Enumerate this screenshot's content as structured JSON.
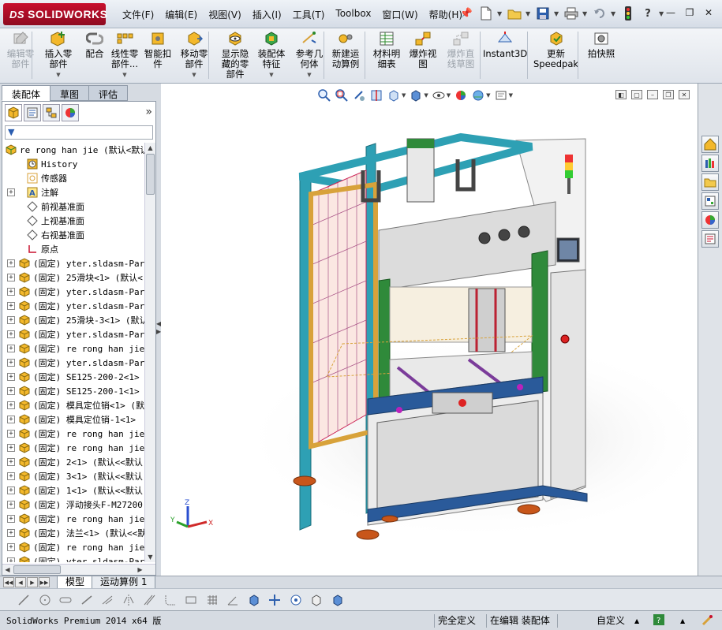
{
  "app": {
    "brand": "SOLIDWORKS",
    "brand_prefix": "DS"
  },
  "menu": [
    "文件(F)",
    "编辑(E)",
    "视图(V)",
    "插入(I)",
    "工具(T)",
    "Toolbox",
    "窗口(W)",
    "帮助(H)"
  ],
  "commands": [
    {
      "label": "编辑零\n部件",
      "icon": "edit-component-icon",
      "enabled": false,
      "dropdown": false
    },
    {
      "label": "插入零\n部件",
      "icon": "insert-component-icon",
      "enabled": true,
      "dropdown": true
    },
    {
      "label": "配合",
      "icon": "mate-icon",
      "enabled": true,
      "dropdown": false
    },
    {
      "label": "线性零\n部件...",
      "icon": "linear-pattern-icon",
      "enabled": true,
      "dropdown": true
    },
    {
      "label": "智能扣\n件",
      "icon": "smart-fasteners-icon",
      "enabled": true,
      "dropdown": false
    },
    {
      "label": "移动零\n部件",
      "icon": "move-component-icon",
      "enabled": true,
      "dropdown": true
    },
    {
      "label": "显示隐\n藏的零\n部件",
      "icon": "show-hidden-icon",
      "enabled": true,
      "dropdown": false
    },
    {
      "label": "装配体\n特征",
      "icon": "assembly-feature-icon",
      "enabled": true,
      "dropdown": true
    },
    {
      "label": "参考几\n何体",
      "icon": "reference-geometry-icon",
      "enabled": true,
      "dropdown": true
    },
    {
      "label": "新建运\n动算例",
      "icon": "new-motion-study-icon",
      "enabled": true,
      "dropdown": false
    },
    {
      "label": "材料明\n细表",
      "icon": "bom-icon",
      "enabled": true,
      "dropdown": false
    },
    {
      "label": "爆炸视\n图",
      "icon": "exploded-view-icon",
      "enabled": true,
      "dropdown": false
    },
    {
      "label": "爆炸直\n线草图",
      "icon": "explode-line-sketch-icon",
      "enabled": false,
      "dropdown": false
    },
    {
      "label": "Instant3D",
      "icon": "instant3d-icon",
      "enabled": true,
      "dropdown": false
    },
    {
      "label": "更新\nSpeedpak",
      "icon": "speedpak-icon",
      "enabled": true,
      "dropdown": false
    },
    {
      "label": "拍快照",
      "icon": "snapshot-icon",
      "enabled": true,
      "dropdown": false
    }
  ],
  "left_tabs": [
    "装配体",
    "草图",
    "评估"
  ],
  "tree": {
    "root": "re rong han jie  (默认<默认",
    "items": [
      {
        "label": "History",
        "icon": "history-icon",
        "expand": false,
        "indent": 1
      },
      {
        "label": "传感器",
        "icon": "sensor-icon",
        "expand": false,
        "indent": 1
      },
      {
        "label": "注解",
        "icon": "annotation-icon",
        "expand": true,
        "indent": 1
      },
      {
        "label": "前视基准面",
        "icon": "plane-icon",
        "expand": false,
        "indent": 1
      },
      {
        "label": "上视基准面",
        "icon": "plane-icon",
        "expand": false,
        "indent": 1
      },
      {
        "label": "右视基准面",
        "icon": "plane-icon",
        "expand": false,
        "indent": 1
      },
      {
        "label": "原点",
        "icon": "origin-icon",
        "expand": false,
        "indent": 1
      },
      {
        "label": "(固定) yter.sldasm-Part",
        "icon": "part-icon",
        "expand": true,
        "indent": 0
      },
      {
        "label": "(固定) 25滑块<1> (默认<",
        "icon": "part-icon",
        "expand": true,
        "indent": 0
      },
      {
        "label": "(固定) yter.sldasm-Part",
        "icon": "part-icon",
        "expand": true,
        "indent": 0
      },
      {
        "label": "(固定) yter.sldasm-Part",
        "icon": "part-icon",
        "expand": true,
        "indent": 0
      },
      {
        "label": "(固定) 25滑块-3<1> (默认",
        "icon": "part-icon",
        "expand": true,
        "indent": 0
      },
      {
        "label": "(固定) yter.sldasm-Part",
        "icon": "part-icon",
        "expand": true,
        "indent": 0
      },
      {
        "label": "(固定) re rong han jie.",
        "icon": "part-icon",
        "expand": true,
        "indent": 0
      },
      {
        "label": "(固定) yter.sldasm-Part",
        "icon": "part-icon",
        "expand": true,
        "indent": 0
      },
      {
        "label": "(固定) SE125-200-2<1> (",
        "icon": "part-icon",
        "expand": true,
        "indent": 0
      },
      {
        "label": "(固定) SE125-200-1<1> (",
        "icon": "part-icon",
        "expand": true,
        "indent": 0
      },
      {
        "label": "(固定) 模具定位销<1> (默",
        "icon": "part-icon",
        "expand": true,
        "indent": 0
      },
      {
        "label": "(固定) 模具定位销-1<1>",
        "icon": "part-icon",
        "expand": true,
        "indent": 0
      },
      {
        "label": "(固定) re rong han jie.",
        "icon": "part-icon",
        "expand": true,
        "indent": 0
      },
      {
        "label": "(固定) re rong han jie.",
        "icon": "part-icon",
        "expand": true,
        "indent": 0
      },
      {
        "label": "(固定) 2<1> (默认<<默认",
        "icon": "part-icon",
        "expand": true,
        "indent": 0
      },
      {
        "label": "(固定) 3<1> (默认<<默认",
        "icon": "part-icon",
        "expand": true,
        "indent": 0
      },
      {
        "label": "(固定) 1<1> (默认<<默认",
        "icon": "part-icon",
        "expand": true,
        "indent": 0
      },
      {
        "label": "(固定) 浮动接头F-M27200",
        "icon": "part-icon",
        "expand": true,
        "indent": 0
      },
      {
        "label": "(固定) re rong han jie.",
        "icon": "part-icon",
        "expand": true,
        "indent": 0
      },
      {
        "label": "(固定) 法兰<1> (默认<<默",
        "icon": "part-icon",
        "expand": true,
        "indent": 0
      },
      {
        "label": "(固定) re rong han jie.",
        "icon": "part-icon",
        "expand": true,
        "indent": 0
      },
      {
        "label": "(固定) yter.sldasm-Part",
        "icon": "part-icon",
        "expand": true,
        "indent": 0
      }
    ]
  },
  "bottom_tabs": [
    "模型",
    "运动算例 1"
  ],
  "status": {
    "product": "SolidWorks Premium 2014 x64 版",
    "fully_defined": "完全定义",
    "editing": "在编辑 装配体",
    "custom": "自定义"
  },
  "colors": {
    "frame_teal": "#2ea0b4",
    "frame_green": "#2f8a3a",
    "frame_orange": "#d8a23a",
    "panel_gray": "#e8e8e8",
    "brand_red": "#c8102e"
  }
}
